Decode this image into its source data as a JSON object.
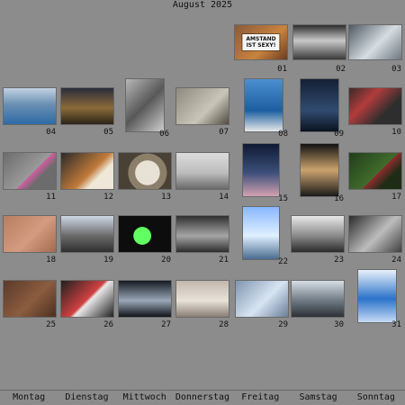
{
  "calendar": {
    "month_title": "August 2025",
    "weekdays": [
      "Montag",
      "Dienstag",
      "Mittwoch",
      "Donnerstag",
      "Freitag",
      "Samstag",
      "Sonntag"
    ]
  },
  "days": [
    {
      "label": "01",
      "sign": {
        "text": "AMSTAND IST SEXY!"
      }
    },
    {
      "label": "02"
    },
    {
      "label": "03"
    },
    {
      "label": "04"
    },
    {
      "label": "05"
    },
    {
      "label": "06"
    },
    {
      "label": "07"
    },
    {
      "label": "08"
    },
    {
      "label": "09"
    },
    {
      "label": "10"
    },
    {
      "label": "11"
    },
    {
      "label": "12"
    },
    {
      "label": "13"
    },
    {
      "label": "14"
    },
    {
      "label": "15"
    },
    {
      "label": "16"
    },
    {
      "label": "17"
    },
    {
      "label": "18"
    },
    {
      "label": "19"
    },
    {
      "label": "20"
    },
    {
      "label": "21"
    },
    {
      "label": "22"
    },
    {
      "label": "23"
    },
    {
      "label": "24"
    },
    {
      "label": "25"
    },
    {
      "label": "26"
    },
    {
      "label": "27"
    },
    {
      "label": "28"
    },
    {
      "label": "29"
    },
    {
      "label": "30"
    },
    {
      "label": "31"
    }
  ]
}
